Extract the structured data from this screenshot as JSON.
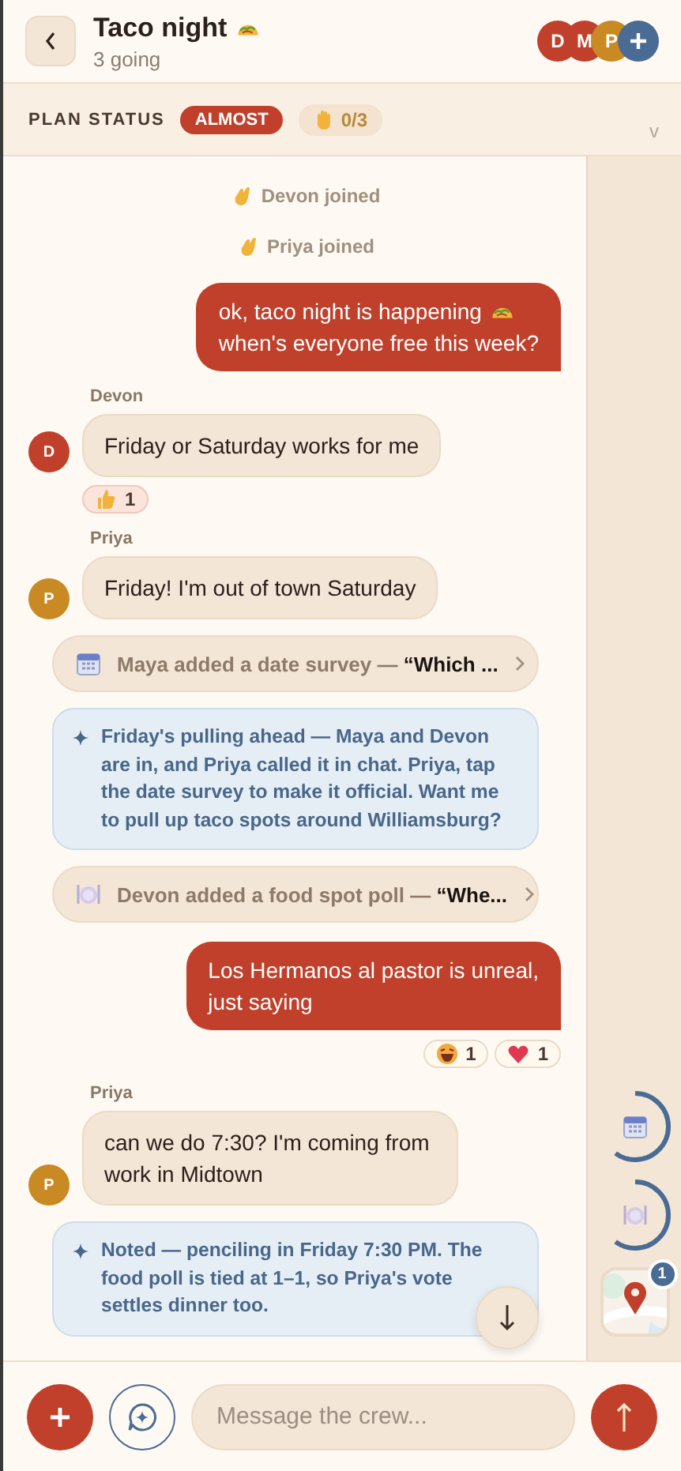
{
  "header": {
    "title": "Taco night",
    "subtitle": "3 going",
    "members": [
      {
        "initial": "D",
        "color": "#c0402b"
      },
      {
        "initial": "M",
        "color": "#c0402b"
      },
      {
        "initial": "P",
        "color": "#c98a23"
      }
    ]
  },
  "plan_status": {
    "label": "PLAN STATUS",
    "badge": "ALMOST",
    "count": "0/3",
    "toggle": "v"
  },
  "messages": [
    {
      "kind": "system",
      "text": "Devon joined"
    },
    {
      "kind": "system",
      "text": "Priya joined"
    },
    {
      "kind": "outgoing",
      "lines": [
        "ok, taco night is happening",
        "when's everyone free this week?"
      ],
      "taco": true
    },
    {
      "kind": "incoming",
      "sender": "Devon",
      "initial": "D",
      "color": "#c0402b",
      "text": "Friday or Saturday works for me",
      "reactions": [
        {
          "kind": "thumbs",
          "count": "1",
          "mine": true
        }
      ]
    },
    {
      "kind": "incoming",
      "sender": "Priya",
      "initial": "P",
      "color": "#c98a23",
      "text": "Friday! I'm out of town Saturday"
    },
    {
      "kind": "date_card",
      "text": "Maya added a date survey — **“Which ...**"
    },
    {
      "kind": "assistant",
      "text": "Friday's pulling ahead — Maya and Devon are in, and Priya called it in chat. Priya, tap the date survey to make it official. Want me to pull up taco spots around Williamsburg?"
    },
    {
      "kind": "food_card",
      "text": "Devon added a food spot poll — **“Whe...**"
    },
    {
      "kind": "outgoing",
      "lines": [
        "Los Hermanos al pastor is unreal,",
        "just saying"
      ],
      "taco": false,
      "reactions": [
        {
          "kind": "laugh",
          "count": "1",
          "mine": false
        },
        {
          "kind": "heart",
          "count": "1",
          "mine": false
        }
      ]
    },
    {
      "kind": "incoming",
      "sender": "Priya",
      "initial": "P",
      "color": "#c98a23",
      "text": "can we do 7:30? I'm coming from work in Midtown"
    },
    {
      "kind": "assistant",
      "text": "Noted — penciling in Friday 7:30 PM. The food poll is tied at 1–1, so Priya's vote settles dinner too."
    }
  ],
  "rail": [
    {
      "kind": "calendar"
    },
    {
      "kind": "plate"
    },
    {
      "kind": "map",
      "badge": "1"
    }
  ],
  "composer": {
    "placeholder": "Message the crew..."
  }
}
